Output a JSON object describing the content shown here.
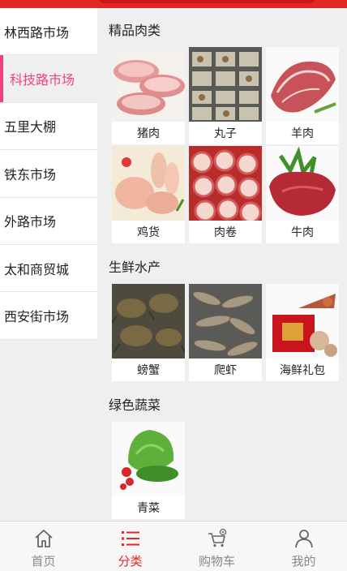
{
  "sidebar": {
    "items": [
      {
        "label": "林西路市场",
        "active": false
      },
      {
        "label": "科技路市场",
        "active": true
      },
      {
        "label": "五里大棚",
        "active": false
      },
      {
        "label": "铁东市场",
        "active": false
      },
      {
        "label": "外路市场",
        "active": false
      },
      {
        "label": "太和商贸城",
        "active": false
      },
      {
        "label": "西安街市场",
        "active": false
      }
    ]
  },
  "sections": [
    {
      "title": "精品肉类",
      "items": [
        "猪肉",
        "丸子",
        "羊肉",
        "鸡货",
        "肉卷",
        "牛肉"
      ]
    },
    {
      "title": "生鲜水产",
      "items": [
        "螃蟹",
        "爬虾",
        "海鲜礼包"
      ]
    },
    {
      "title": "绿色蔬菜",
      "items": [
        "青菜"
      ]
    }
  ],
  "tabbar": {
    "tabs": [
      {
        "label": "首页",
        "icon": "home-icon",
        "active": false
      },
      {
        "label": "分类",
        "icon": "list-icon",
        "active": true
      },
      {
        "label": "购物车",
        "icon": "cart-icon",
        "active": false
      },
      {
        "label": "我的",
        "icon": "user-icon",
        "active": false
      }
    ]
  },
  "colors": {
    "accent": "#e32727",
    "active_side": "#f0417d"
  }
}
